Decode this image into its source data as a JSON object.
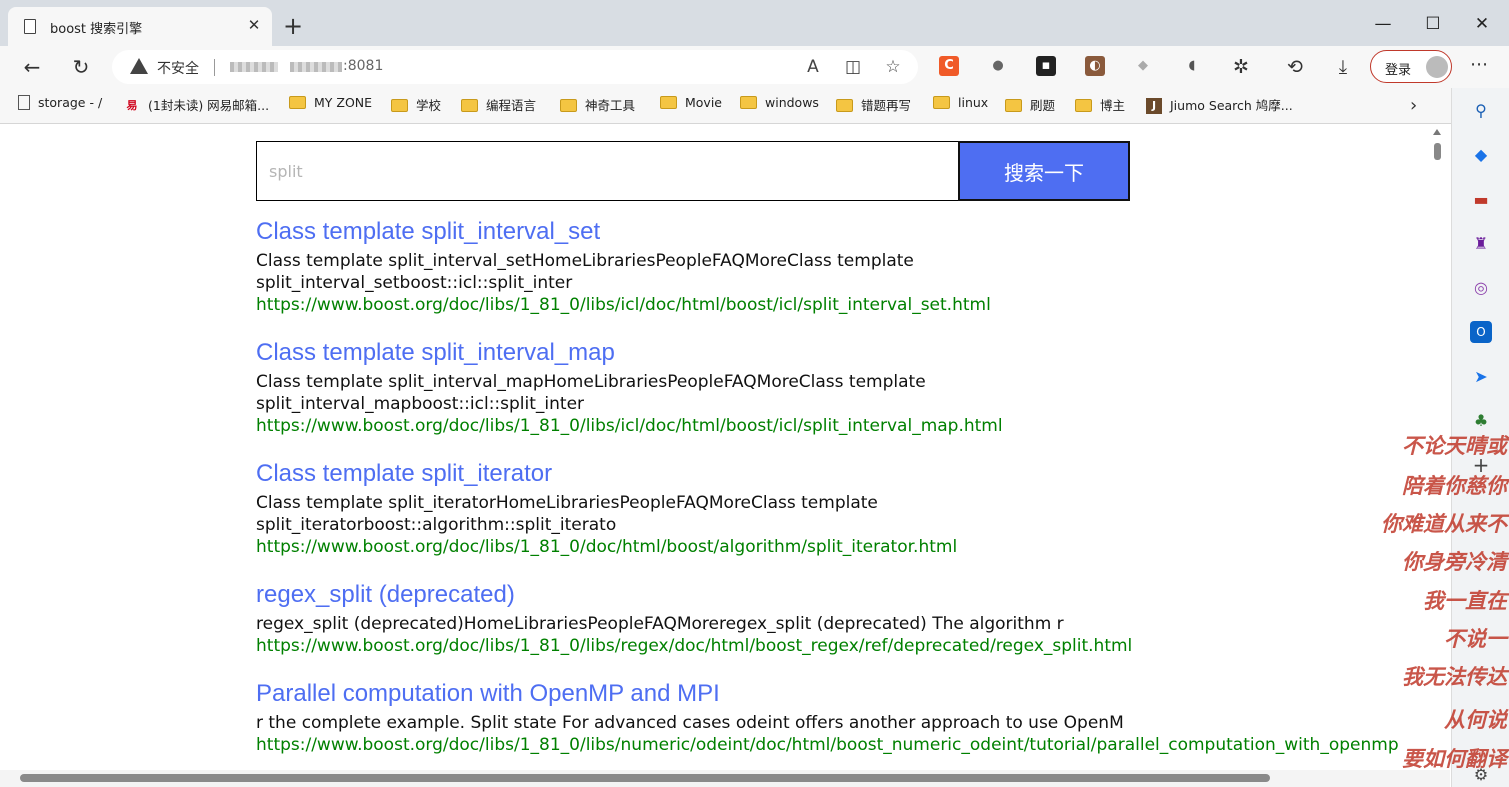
{
  "browser": {
    "tab_title": "boost 搜索引擎",
    "tab_close": "✕",
    "new_tab": "+",
    "security_label": "不安全",
    "url_port": ":8081",
    "login_label": "登录",
    "minimize": "—",
    "maximize": "☐",
    "close": "✕"
  },
  "bookmarks": [
    {
      "label": "storage - /",
      "icon": "document-icon"
    },
    {
      "label": "(1封未读) 网易邮箱...",
      "icon": "mail-icon"
    },
    {
      "label": "MY ZONE",
      "icon": "folder-icon"
    },
    {
      "label": "学校",
      "icon": "folder-icon"
    },
    {
      "label": "编程语言",
      "icon": "folder-icon"
    },
    {
      "label": "神奇工具",
      "icon": "folder-icon"
    },
    {
      "label": "Movie",
      "icon": "folder-icon"
    },
    {
      "label": "windows",
      "icon": "folder-icon"
    },
    {
      "label": "错题再写",
      "icon": "folder-icon"
    },
    {
      "label": "linux",
      "icon": "folder-icon"
    },
    {
      "label": "刷题",
      "icon": "folder-icon"
    },
    {
      "label": "博主",
      "icon": "folder-icon"
    },
    {
      "label": "Jiumo Search 鸠摩...",
      "icon": "jiumo-icon"
    }
  ],
  "search": {
    "placeholder": "split",
    "button_label": "搜索一下"
  },
  "results": [
    {
      "title": "Class template split_interval_set",
      "desc": "Class template split_interval_setHomeLibrariesPeopleFAQMoreClass template split_interval_setboost::icl::split_inter",
      "url": "https://www.boost.org/doc/libs/1_81_0/libs/icl/doc/html/boost/icl/split_interval_set.html"
    },
    {
      "title": "Class template split_interval_map",
      "desc": "Class template split_interval_mapHomeLibrariesPeopleFAQMoreClass template split_interval_mapboost::icl::split_inter",
      "url": "https://www.boost.org/doc/libs/1_81_0/libs/icl/doc/html/boost/icl/split_interval_map.html"
    },
    {
      "title": "Class template split_iterator",
      "desc": "Class template split_iteratorHomeLibrariesPeopleFAQMoreClass template split_iteratorboost::algorithm::split_iterato",
      "url": "https://www.boost.org/doc/libs/1_81_0/doc/html/boost/algorithm/split_iterator.html"
    },
    {
      "title": "regex_split (deprecated)",
      "desc": "regex_split (deprecated)HomeLibrariesPeopleFAQMoreregex_split (deprecated) The algorithm r",
      "url": "https://www.boost.org/doc/libs/1_81_0/libs/regex/doc/html/boost_regex/ref/deprecated/regex_split.html"
    },
    {
      "title": "Parallel computation with OpenMP and MPI",
      "desc": "r the complete example. Split state For advanced cases odeint offers another approach to use OpenM",
      "url": "https://www.boost.org/doc/libs/1_81_0/libs/numeric/odeint/doc/html/boost_numeric_odeint/tutorial/parallel_computation_with_openmp"
    }
  ],
  "overlay_lines": [
    "不论天晴或",
    "陪着你慈你",
    "你难道从来不",
    "你身旁冷清",
    "我一直在",
    "不说一",
    "我无法传达",
    "从何说",
    "要如何翻译"
  ],
  "colors": {
    "link": "#4e6ef2",
    "url": "#008000",
    "search_button": "#4e6ef2",
    "overlay": "#c0392b"
  }
}
